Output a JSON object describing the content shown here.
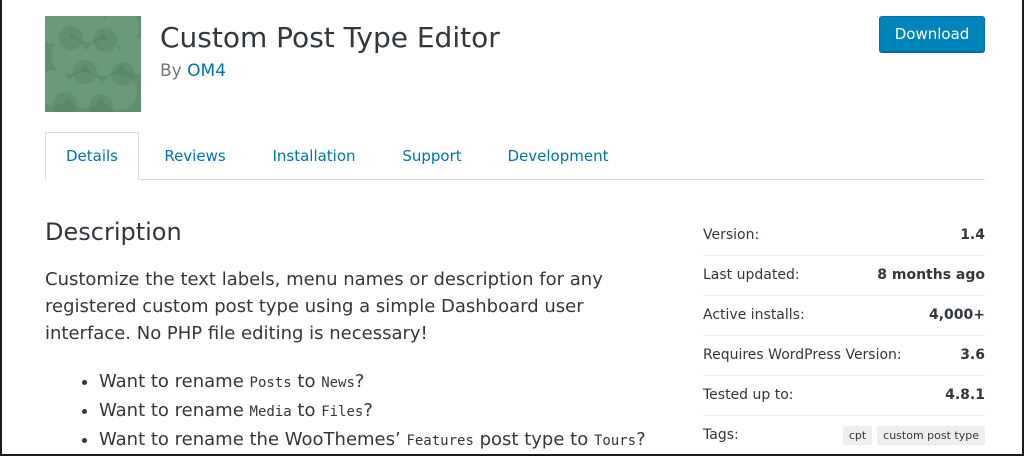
{
  "plugin": {
    "title": "Custom Post Type Editor",
    "by_label": "By",
    "author": "OM4",
    "download_label": "Download"
  },
  "tabs": [
    {
      "label": "Details",
      "active": true
    },
    {
      "label": "Reviews"
    },
    {
      "label": "Installation"
    },
    {
      "label": "Support"
    },
    {
      "label": "Development"
    }
  ],
  "description": {
    "heading": "Description",
    "paragraph": "Customize the text labels, menu names or description for any registered custom post type using a simple Dashboard user interface. No PHP file editing is necessary!",
    "bullets": [
      {
        "pre": "Want to rename ",
        "code1": "Posts",
        "mid": " to ",
        "code2": "News",
        "post": "?"
      },
      {
        "pre": "Want to rename ",
        "code1": "Media",
        "mid": " to ",
        "code2": "Files",
        "post": "?"
      },
      {
        "pre": "Want to rename the WooThemes’ ",
        "code1": "Features",
        "mid": " post type to ",
        "code2": "Tours",
        "post": "?"
      }
    ]
  },
  "meta": {
    "version_label": "Version:",
    "version": "1.4",
    "updated_label": "Last updated:",
    "updated": "8 months ago",
    "installs_label": "Active installs:",
    "installs": "4,000+",
    "requires_label": "Requires WordPress Version:",
    "requires": "3.6",
    "tested_label": "Tested up to:",
    "tested": "4.8.1",
    "tags_label": "Tags:",
    "tags": [
      "cpt",
      "custom post type"
    ]
  },
  "colors": {
    "accent": "#0085ba",
    "link": "#0073aa",
    "icon_bg": "#5f8f6f"
  }
}
